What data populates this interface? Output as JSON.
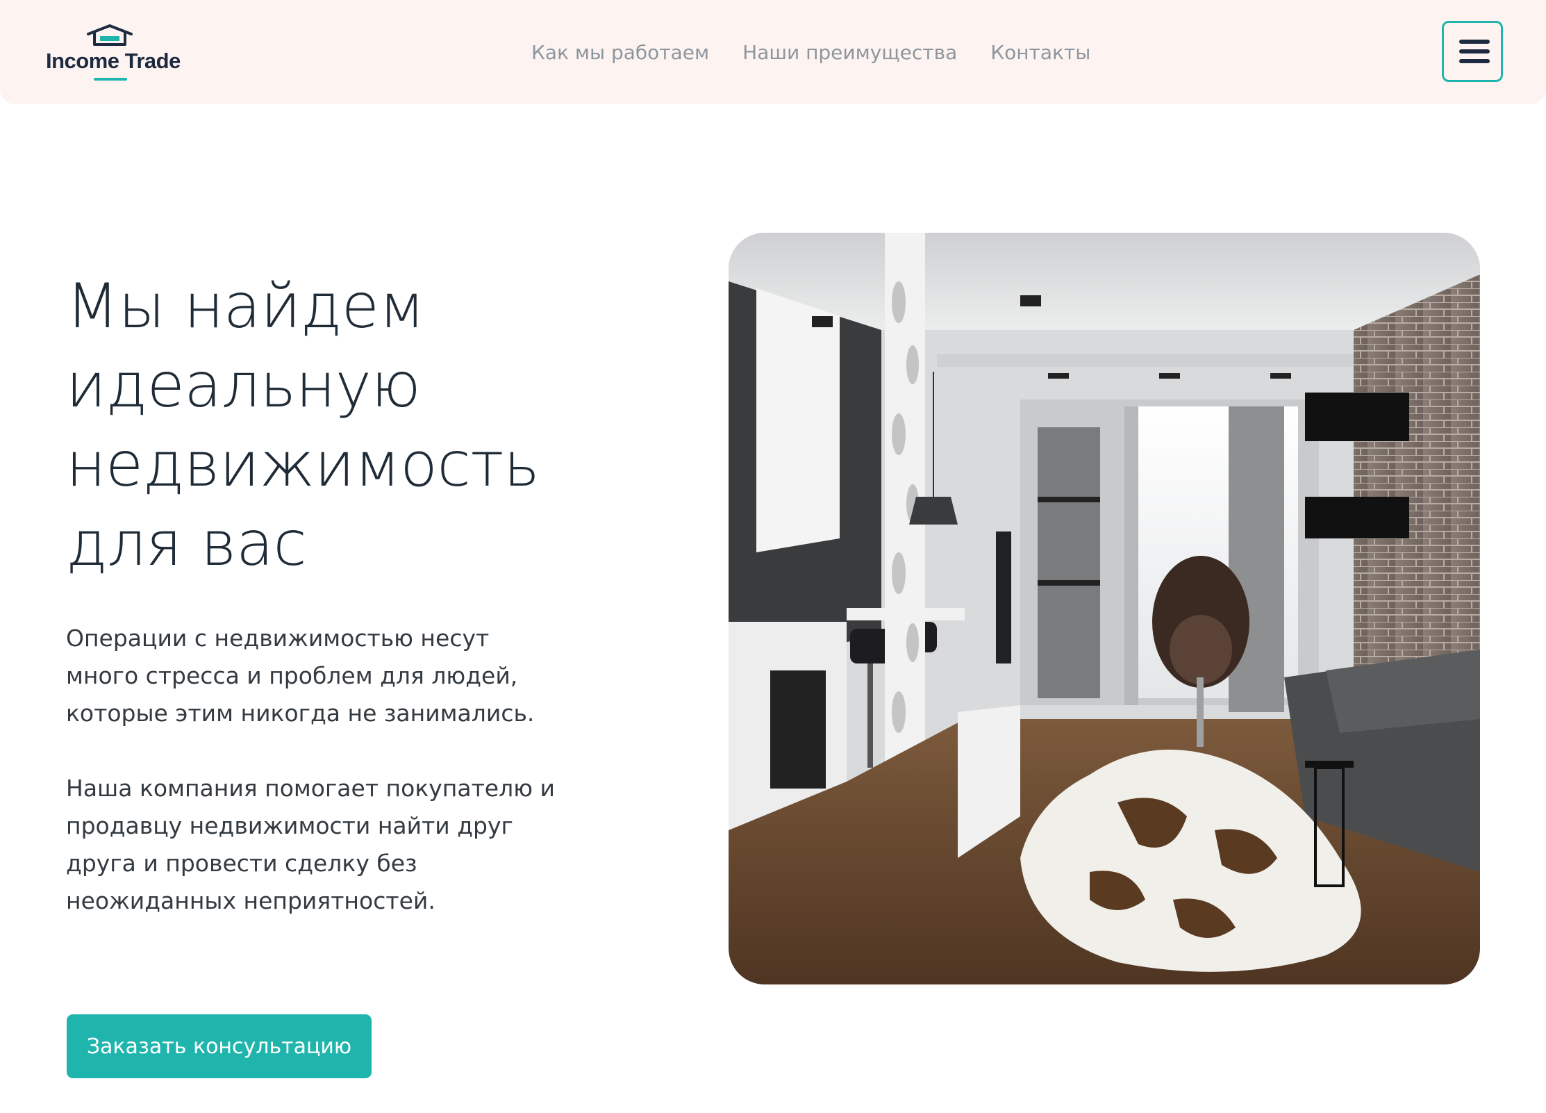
{
  "header": {
    "logo_text": "Income Trade",
    "nav": [
      {
        "label": "Как мы работаем"
      },
      {
        "label": "Наши преимущества"
      },
      {
        "label": "Контакты"
      }
    ],
    "menu_icon": "hamburger-menu-icon"
  },
  "hero": {
    "title": "Мы найдем идеальную недвижимость для вас",
    "paragraph_1": "Операции с недвижимостью несут много стресса и проблем для людей, которые этим никогда не занимались.",
    "paragraph_2": "Наша компания помогает покупателю и продавцу недвижимости найти друг друга и провести сделку без неожиданных неприятностей.",
    "cta_label": "Заказать консультацию"
  },
  "colors": {
    "accent": "#1fb5ac",
    "header_bg": "#fdf4f2",
    "text_dark": "#1f2b36",
    "nav_text": "#8e969d"
  }
}
